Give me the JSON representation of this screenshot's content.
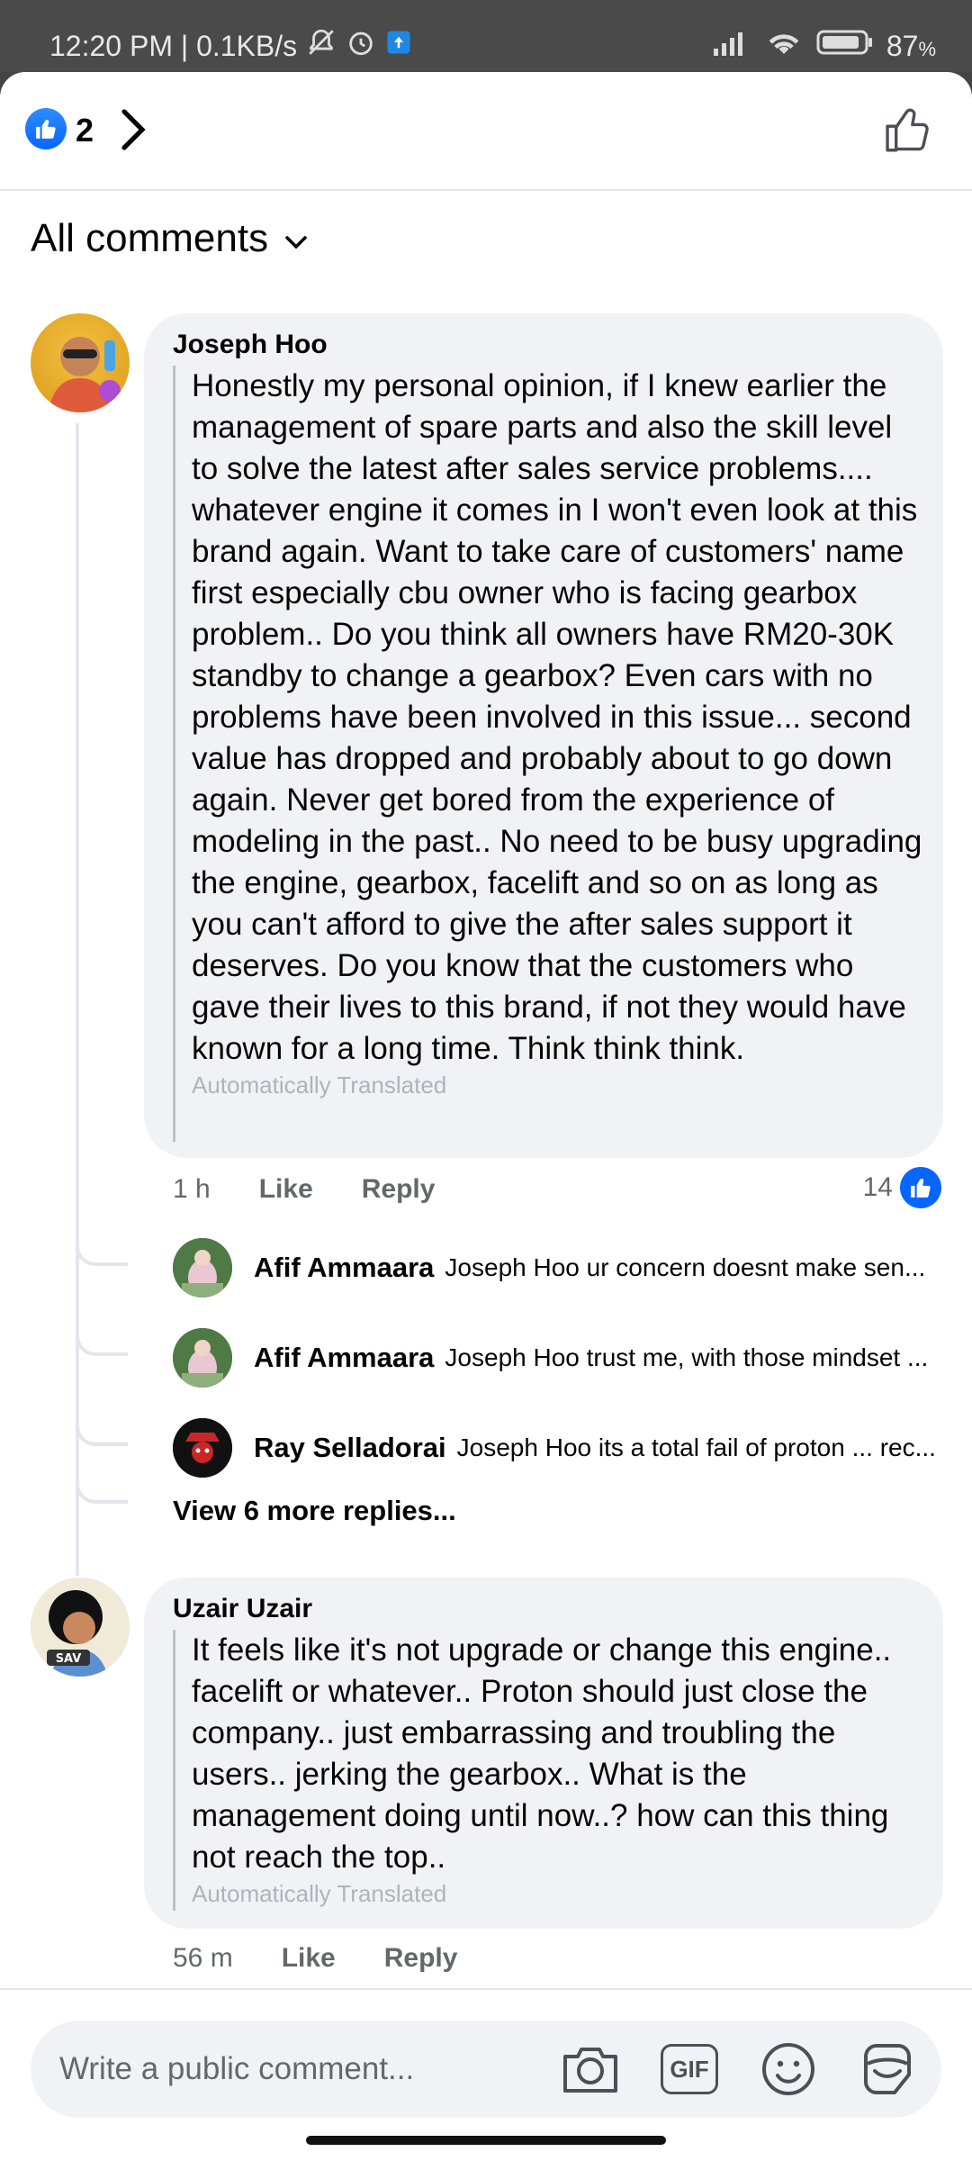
{
  "status_bar": {
    "time_speed": "12:20 PM | 0.1KB/s",
    "battery": "87"
  },
  "header": {
    "like_count": "2"
  },
  "filter": {
    "label": "All comments"
  },
  "comments": [
    {
      "author": "Joseph Hoo",
      "text": "Honestly my personal opinion, if I knew earlier the management of spare parts and also the skill level to solve the latest after sales service problems.... whatever engine it comes in I won't even look at this brand again. Want to take care of customers' name first especially cbu owner who is facing gearbox problem.. Do you think all owners have RM20-30K standby to change a gearbox? Even cars with no problems have been involved in this issue... second value has dropped and probably about to go down again. Never get bored from the experience of modeling in the past.. No need to be busy upgrading the engine, gearbox, facelift and so on as long as you can't afford to give the after sales support it deserves. Do you know that the customers who gave their lives to this brand, if not they would have known for a long time. Think think think.",
      "translated_note": "Automatically Translated",
      "time": "1 h",
      "like_label": "Like",
      "reply_label": "Reply",
      "reaction_count": "14",
      "replies": [
        {
          "author": "Afif Ammaara",
          "snippet": "Joseph Hoo ur concern doesnt make sen..."
        },
        {
          "author": "Afif Ammaara",
          "snippet": "Joseph Hoo trust me, with those mindset ..."
        },
        {
          "author": "Ray Selladorai",
          "snippet": "Joseph Hoo its a total fail of proton ... rec..."
        }
      ],
      "view_more": "View 6 more replies..."
    },
    {
      "author": "Uzair Uzair",
      "text": "It feels like it's not upgrade or change this engine.. facelift or whatever.. Proton should just close the company.. just embarrassing and troubling the users.. jerking the gearbox.. What is the management doing until now..? how can this thing not reach the top..",
      "translated_note": "Automatically Translated",
      "time": "56 m",
      "like_label": "Like",
      "reply_label": "Reply",
      "avatar_badge": "SAV"
    }
  ],
  "composer": {
    "placeholder": "Write a public comment..."
  },
  "icons": {
    "gif_label": "GIF"
  },
  "colors": {
    "like_blue": "#0866ff",
    "bubble_bg": "#f0f2f5",
    "secondary_text": "#65676b"
  }
}
